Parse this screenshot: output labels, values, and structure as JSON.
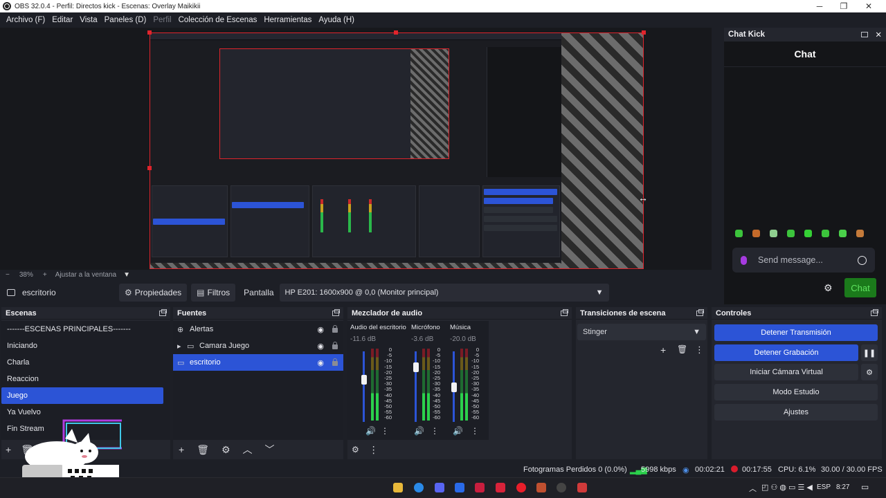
{
  "window": {
    "title": "OBS 32.0.4 - Perfil: Directos kick - Escenas: Overlay Maikikii",
    "minimize": "─",
    "maximize": "❐",
    "close": "✕"
  },
  "menu": {
    "items": [
      "Archivo (F)",
      "Editar",
      "Vista",
      "Paneles (D)",
      "Perfil",
      "Colección de Escenas",
      "Herramientas",
      "Ayuda (H)"
    ]
  },
  "zoom": {
    "minus": "−",
    "value": "38%",
    "plus": "+",
    "fit_label": "Ajustar a la ventana"
  },
  "source_toolbar": {
    "source_name": "escritorio",
    "properties_label": "Propiedades",
    "filters_label": "Filtros",
    "screen_label": "Pantalla",
    "screen_value": "HP E201: 1600x900 @ 0,0 (Monitor principal)"
  },
  "scenes": {
    "title": "Escenas",
    "items": [
      "-------ESCENAS PRINCIPALES-------",
      "Iniciando",
      "Charla",
      "Reaccion",
      "Juego",
      "Ya Vuelvo",
      "Fin Stream"
    ],
    "selected_index": 4
  },
  "sources": {
    "title": "Fuentes",
    "items": [
      {
        "label": "Alertas",
        "icon": "globe-icon"
      },
      {
        "label": "Camara Juego",
        "icon": "folder-icon"
      },
      {
        "label": "escritorio",
        "icon": "monitor-icon"
      }
    ],
    "selected_index": 2
  },
  "mixer": {
    "title": "Mezclador de audio",
    "channels": [
      {
        "name": "Audio del escritorio",
        "db": "-11.6 dB",
        "level": 0.62
      },
      {
        "name": "Micrófono",
        "db": "-3.6 dB",
        "level": 0.82
      },
      {
        "name": "Música",
        "db": "-20.0 dB",
        "level": 0.5
      }
    ],
    "scale": [
      "0",
      "-5",
      "-10",
      "-15",
      "-20",
      "-25",
      "-30",
      "-35",
      "-40",
      "-45",
      "-50",
      "-55",
      "-60"
    ]
  },
  "transitions": {
    "title": "Transiciones de escena",
    "selected": "Stinger"
  },
  "controls": {
    "title": "Controles",
    "stop_stream": "Detener Transmisión",
    "stop_recording": "Detener Grabación",
    "virtual_cam": "Iniciar Cámara Virtual",
    "studio_mode": "Modo Estudio",
    "settings": "Ajustes"
  },
  "chat": {
    "dock_title": "Chat Kick",
    "title": "Chat",
    "placeholder": "Send message...",
    "send_label": "Chat"
  },
  "status": {
    "dropped_frames": "Fotogramas Perdidos 0 (0.0%)",
    "bitrate": "5998 kbps",
    "stream_time": "00:02:21",
    "rec_time": "00:17:55",
    "cpu": "CPU: 6.1%",
    "fps": "30.00 / 30.00 FPS"
  },
  "taskbar": {
    "language": "ESP",
    "time": "8:27"
  },
  "colors": {
    "accent": "#2c54d6",
    "record_red": "#d91c2c",
    "chat_green": "#1b7a1b",
    "selection_red": "#e0242c"
  }
}
